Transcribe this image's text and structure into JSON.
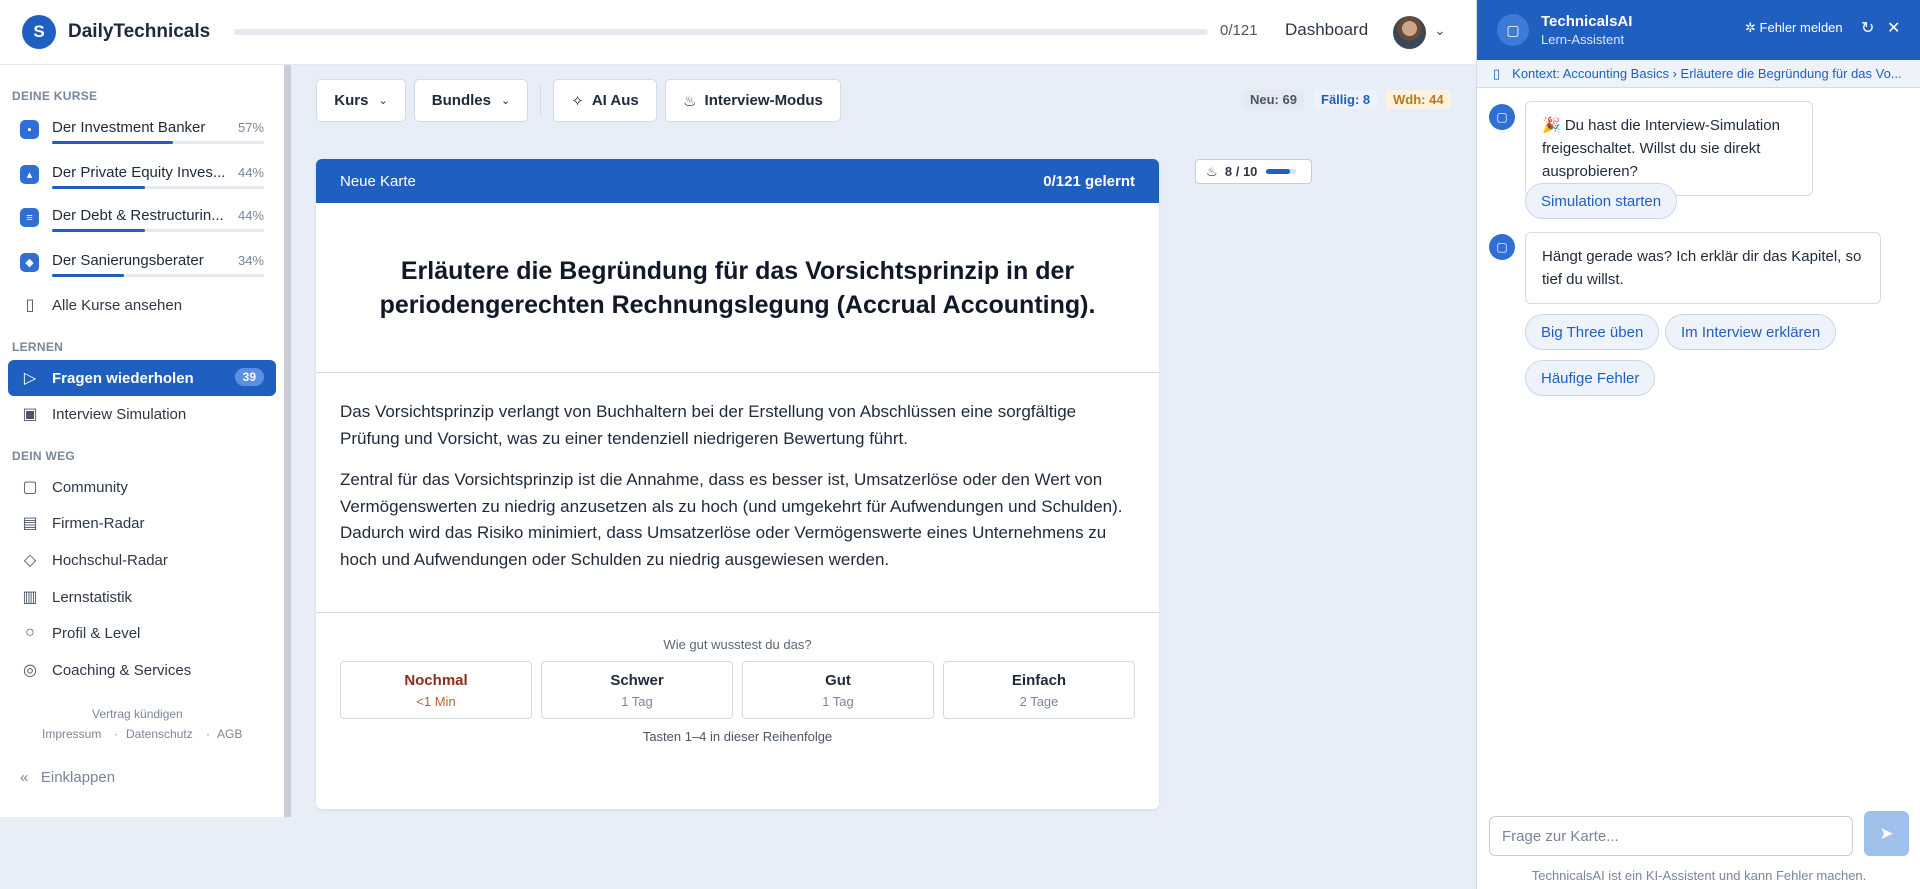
{
  "app": {
    "name": "DailyTechnicals",
    "logo_letter": "S",
    "brand_color": "#1f5fbf"
  },
  "topbar": {
    "progress": "0/121",
    "dashboard": "Dashboard"
  },
  "sidebar": {
    "courses_head": "DEINE KURSE",
    "courses": [
      {
        "name": "Der Investment Banker",
        "pct": "57%",
        "progress": 0.57,
        "icon": "briefcase-icon"
      },
      {
        "name": "Der Private Equity Inves...",
        "pct": "44%",
        "progress": 0.44,
        "icon": "chart-icon"
      },
      {
        "name": "Der Debt & Restructurin...",
        "pct": "44%",
        "progress": 0.44,
        "icon": "document-icon"
      },
      {
        "name": "Der Sanierungsberater",
        "pct": "34%",
        "progress": 0.34,
        "icon": "shield-icon"
      }
    ],
    "all_courses": "Alle Kurse ansehen",
    "learn_head": "LERNEN",
    "review": "Fragen wiederholen",
    "review_count": "39",
    "interview_sim": "Interview Simulation",
    "path_head": "DEIN WEG",
    "path": [
      "Community",
      "Firmen-Radar",
      "Hochschul-Radar",
      "Lernstatistik",
      "Profil & Level",
      "Coaching & Services"
    ],
    "cancel": "Vertrag kündigen",
    "impressum": "Impressum",
    "datenschutz": "Datenschutz",
    "agb": "AGB",
    "collapse": "Einklappen"
  },
  "toolbar": {
    "kurs": "Kurs",
    "bundles": "Bundles",
    "ai": "AI Aus",
    "interview": "Interview-Modus",
    "neu": "Neu: 69",
    "faellig": "Fällig: 8",
    "wdh": "Wdh: 44"
  },
  "card": {
    "label": "Neue Karte",
    "learned": "0/121 gelernt",
    "question": "Erläutere die Begründung für das Vorsichtsprinzip in der periodengerechten Rechnungslegung (Accrual Accounting).",
    "answer_p1": "Das Vorsichtsprinzip verlangt von Buchhaltern bei der Erstellung von Abschlüssen eine sorgfältige Prüfung und Vorsicht, was zu einer tendenziell niedrigeren Bewertung führt.",
    "answer_p2": "Zentral für das Vorsichtsprinzip ist die Annahme, dass es besser ist, Umsatzerlöse oder den Wert von Vermögenswerten zu niedrig anzusetzen als zu hoch (und umgekehrt für Aufwendungen und Schulden). Dadurch wird das Risiko minimiert, dass Umsatzerlöse oder Vermögenswerte eines Unternehmens zu hoch und Aufwendungen oder Schulden zu niedrig ausgewiesen werden.",
    "rate_question": "Wie gut wusstest du das?",
    "ratings": [
      {
        "label": "Nochmal",
        "interval": "<1 Min"
      },
      {
        "label": "Schwer",
        "interval": "1 Tag"
      },
      {
        "label": "Gut",
        "interval": "1 Tag"
      },
      {
        "label": "Einfach",
        "interval": "2 Tage"
      }
    ],
    "hint": "Tasten 1–4 in dieser Reihenfolge"
  },
  "streak": {
    "text": "8 / 10",
    "progress": 0.8
  },
  "chat": {
    "title": "TechnicalsAI",
    "subtitle": "Lern-Assistent",
    "report": "Fehler melden",
    "context": "Kontext: Accounting Basics › Erläutere die Begründung für das Vo...",
    "msg1": "🎉 Du hast die Interview-Simulation freigeschaltet. Willst du sie direkt ausprobieren?",
    "chip_start": "Simulation starten",
    "msg2": "Hängt gerade was? Ich erklär dir das Kapitel, so tief du willst.",
    "chip_big_three": "Big Three üben",
    "chip_explain": "Im Interview erklären",
    "chip_errors": "Häufige Fehler",
    "placeholder": "Frage zur Karte...",
    "disclaimer": "TechnicalsAI ist ein KI-Assistent und kann Fehler machen."
  }
}
